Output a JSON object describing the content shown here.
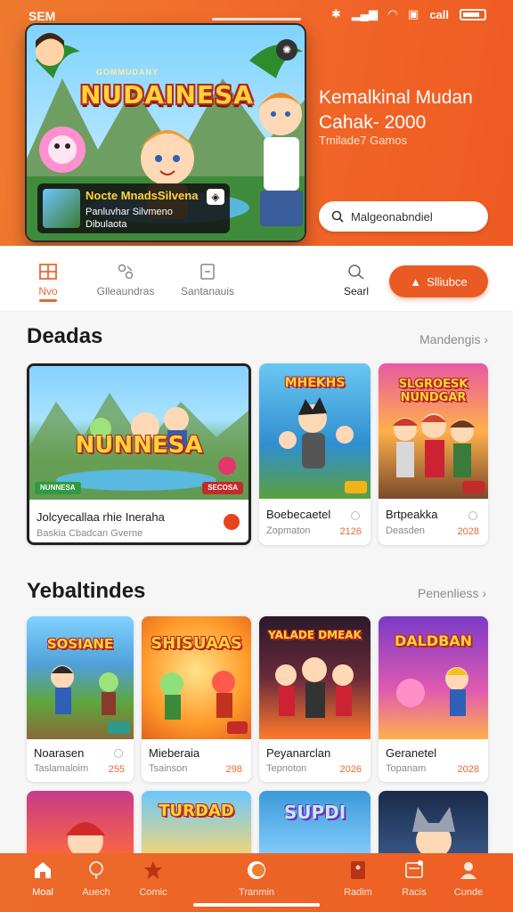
{
  "status": {
    "left": "SEM",
    "carrier": "call"
  },
  "hero": {
    "small_title": "GOMMUDANY",
    "big_title": "NUDAINESA",
    "info_title": "Nocte MnadsSilvena",
    "info_line1": "Panluvhar Silvmeno",
    "info_line2": "Dibulaota"
  },
  "headline": {
    "title_line1": "Kemalkinal Mudan",
    "title_line2": "Cahak- 2000",
    "subtitle": "Tmilade7 Gamos"
  },
  "search": {
    "value": "Malgeonabndiel"
  },
  "nav": {
    "items": [
      {
        "label": "Nvo",
        "icon": "grid-icon"
      },
      {
        "label": "Glleaundras",
        "icon": "shapes-icon"
      },
      {
        "label": "Santanauis",
        "icon": "document-icon"
      },
      {
        "label": "Searl",
        "icon": "search-icon"
      }
    ],
    "subscribe_label": "Slliubce"
  },
  "section1": {
    "title": "Deadas",
    "more": "Mandengis",
    "cards": [
      {
        "art_text": "NUNNESA",
        "title": "Jolcyecallaa rhie Ineraha",
        "subtitle": "Baskia Cbadcan Gverne",
        "tag_left": "NUNNESA",
        "tag_right": "SECOSA"
      },
      {
        "art_text": "MHEKHS",
        "title": "Boebecaetel",
        "subtitle": "Zopmaton",
        "num": "2126"
      },
      {
        "art_text": "SLGROESK NUNDGAR",
        "title": "Brtpeakka",
        "subtitle": "Deasden",
        "num": "2028"
      }
    ]
  },
  "section2": {
    "title": "Yebaltindes",
    "more": "Penenliess",
    "cards": [
      {
        "art_text": "SOSIANE",
        "title": "Noarasen",
        "subtitle": "Taslamaloim",
        "num": "255"
      },
      {
        "art_text": "SHISUAAS",
        "title": "Mieberaia",
        "subtitle": "Tsainson",
        "num": "298"
      },
      {
        "art_text": "YALADE DMEAK",
        "title": "Peyanarclan",
        "subtitle": "Tepnoton",
        "num": "2026"
      },
      {
        "art_text": "DALDBAN",
        "title": "Geranetel",
        "subtitle": "Topanam",
        "num": "2028"
      }
    ],
    "row3_art": [
      "",
      "TURDAD",
      "SUPDI",
      ""
    ]
  },
  "bottom_tabs": [
    {
      "label": "Moal",
      "icon": "home-icon"
    },
    {
      "label": "Auech",
      "icon": "pin-icon"
    },
    {
      "label": "Comic",
      "icon": "star-icon"
    },
    {
      "label": "Tranmin",
      "icon": "disc-icon"
    },
    {
      "label": "Radim",
      "icon": "bookmark-icon"
    },
    {
      "label": "Racis",
      "icon": "inbox-icon"
    },
    {
      "label": "Cunde",
      "icon": "profile-icon"
    }
  ],
  "colors": {
    "accent": "#ea5b24",
    "header": "#f26a2a",
    "price": "#e8692f"
  }
}
